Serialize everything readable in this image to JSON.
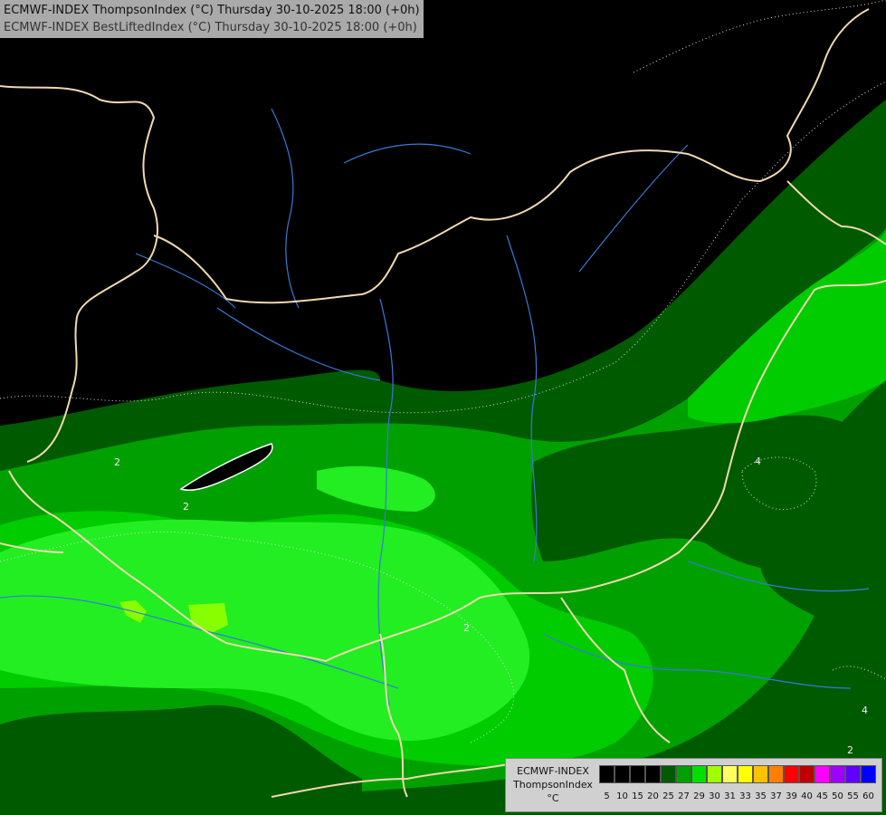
{
  "header": {
    "line1": "ECMWF-INDEX ThompsonIndex (°C) Thursday 30-10-2025 18:00 (+0h)",
    "line2": "ECMWF-INDEX BestLiftedIndex (°C) Thursday 30-10-2025 18:00 (+0h)"
  },
  "legend": {
    "model": "ECMWF-INDEX",
    "variable": "ThompsonIndex",
    "unit": "°C",
    "ticks": [
      "5",
      "10",
      "15",
      "20",
      "25",
      "27",
      "29",
      "30",
      "31",
      "33",
      "35",
      "37",
      "39",
      "40",
      "45",
      "50",
      "55",
      "60"
    ],
    "colors": [
      "#000000",
      "#000000",
      "#000000",
      "#000000",
      "#005a00",
      "#00a000",
      "#00e000",
      "#a0ff00",
      "#ffff60",
      "#ffff00",
      "#ffc000",
      "#ff8000",
      "#ff0000",
      "#c00000",
      "#ff00ff",
      "#a000ff",
      "#6000ff",
      "#0000ff"
    ]
  },
  "map": {
    "contour_labels": [
      "2",
      "2",
      "2",
      "4",
      "4",
      "2"
    ],
    "colors": {
      "background": "#000000",
      "dark_green": "#005a00",
      "mid_green": "#00a000",
      "green": "#00cc00",
      "bright_green": "#22ee22",
      "lime": "#88ff00",
      "border": "#f0d8b0",
      "river": "#3a78d8"
    }
  }
}
